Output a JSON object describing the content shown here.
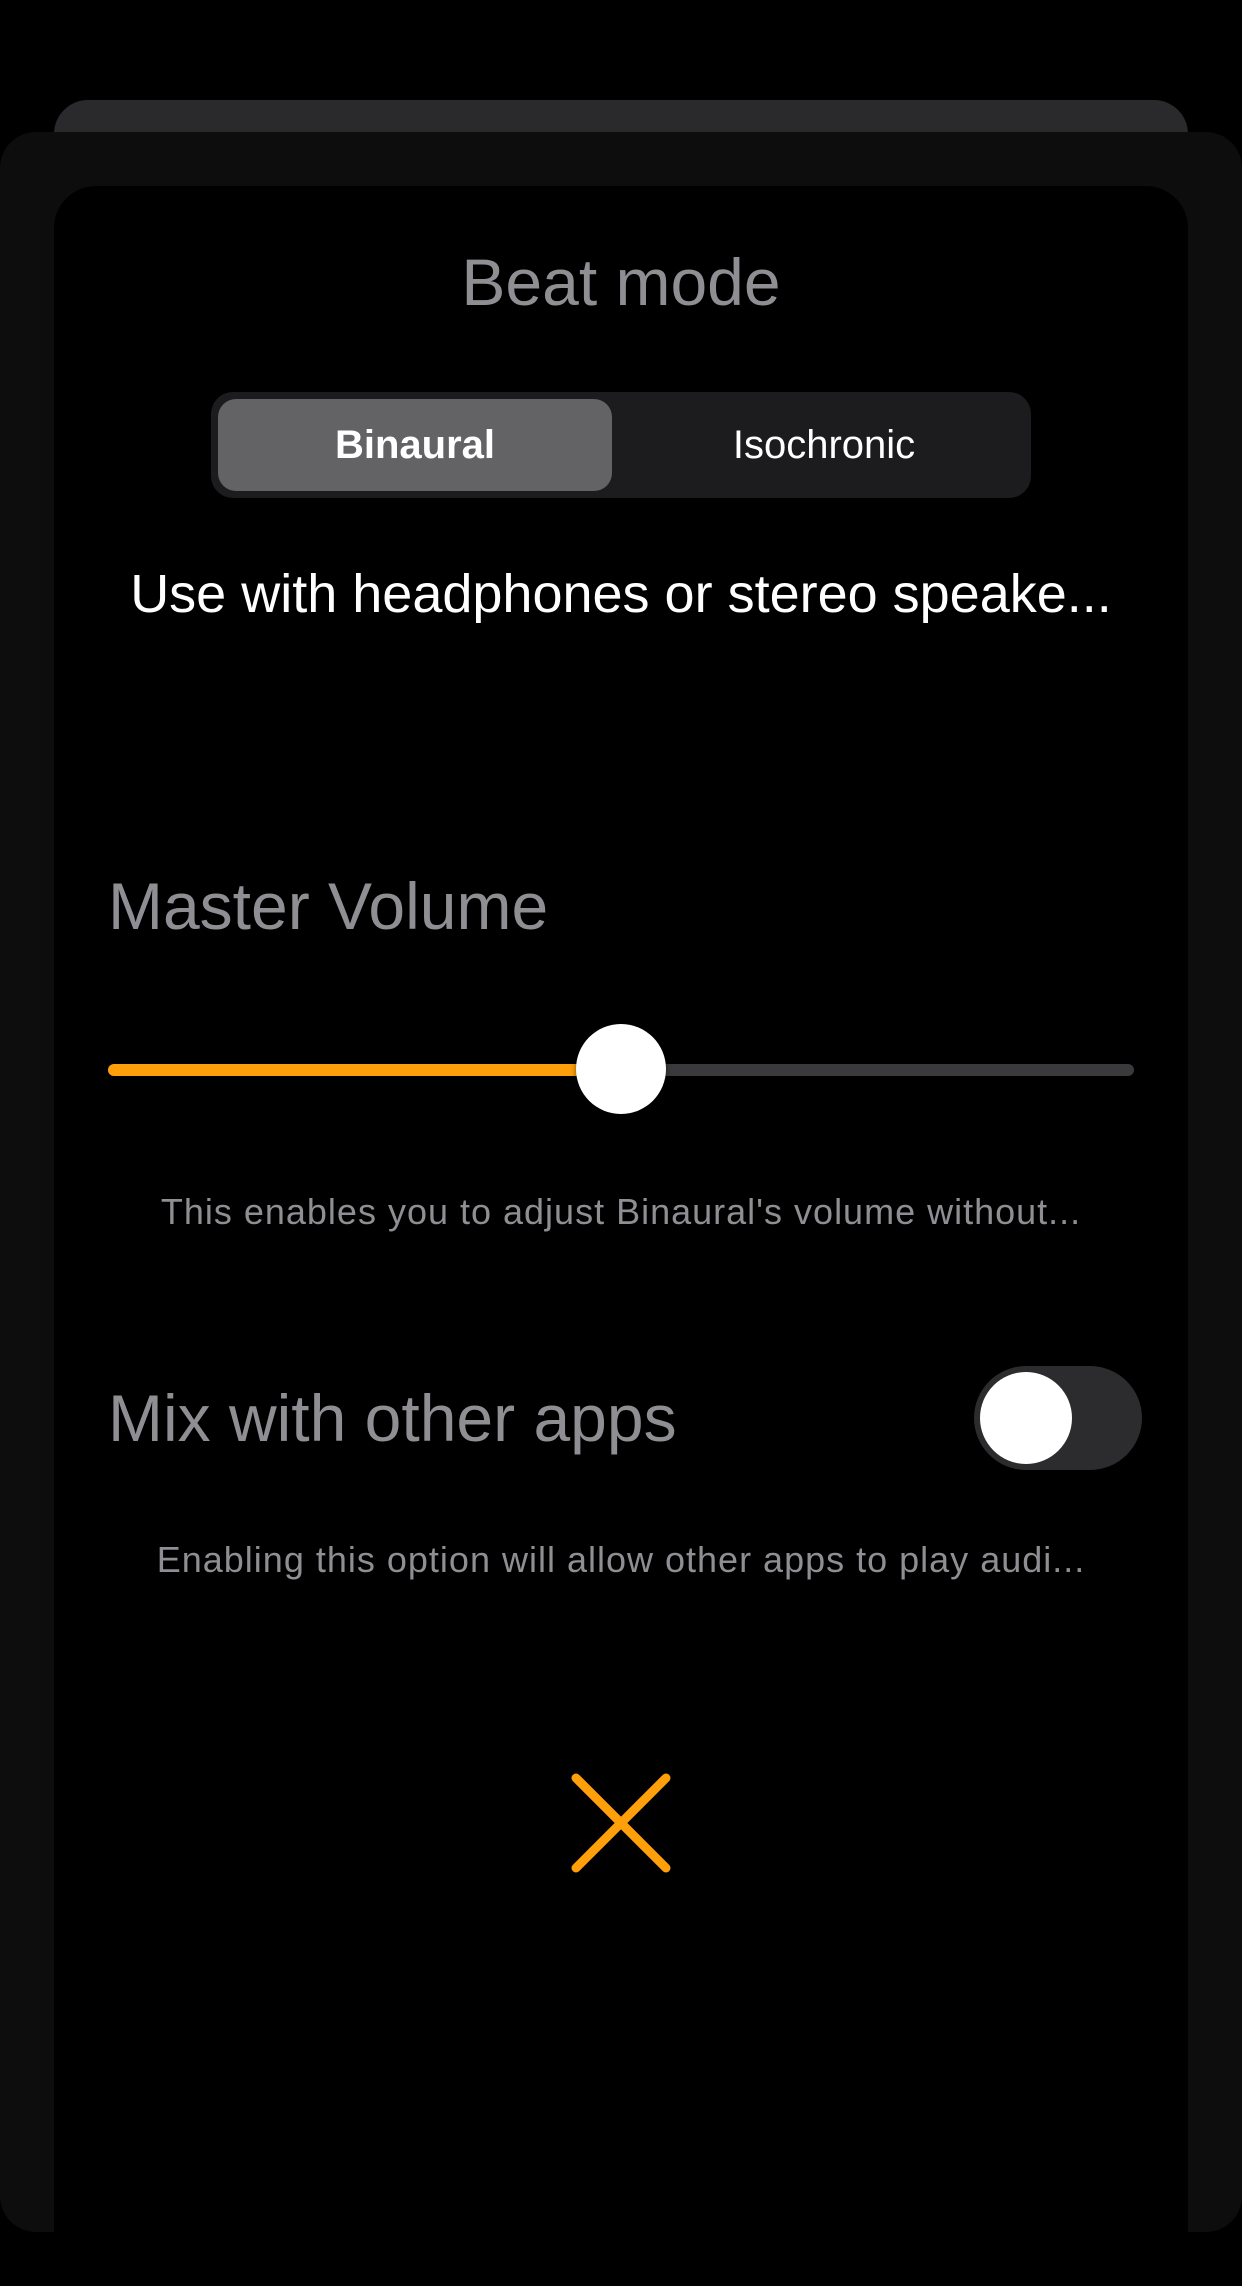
{
  "sheet": {
    "title": "Beat mode",
    "segments": [
      {
        "label": "Binaural",
        "selected": true
      },
      {
        "label": "Isochronic",
        "selected": false
      }
    ],
    "mode_description": "Use with headphones or stereo speake..."
  },
  "volume": {
    "label": "Master Volume",
    "level": 0.5,
    "help": "This enables you to adjust Binaural's volume without..."
  },
  "mix": {
    "label": "Mix with other apps",
    "enabled": false,
    "help": "Enabling this option will allow other apps to play audi..."
  },
  "close": {
    "icon": "close-icon"
  },
  "colors": {
    "accent": "#ff9f0a",
    "background": "#000000",
    "muted_text": "#8e8e93"
  }
}
